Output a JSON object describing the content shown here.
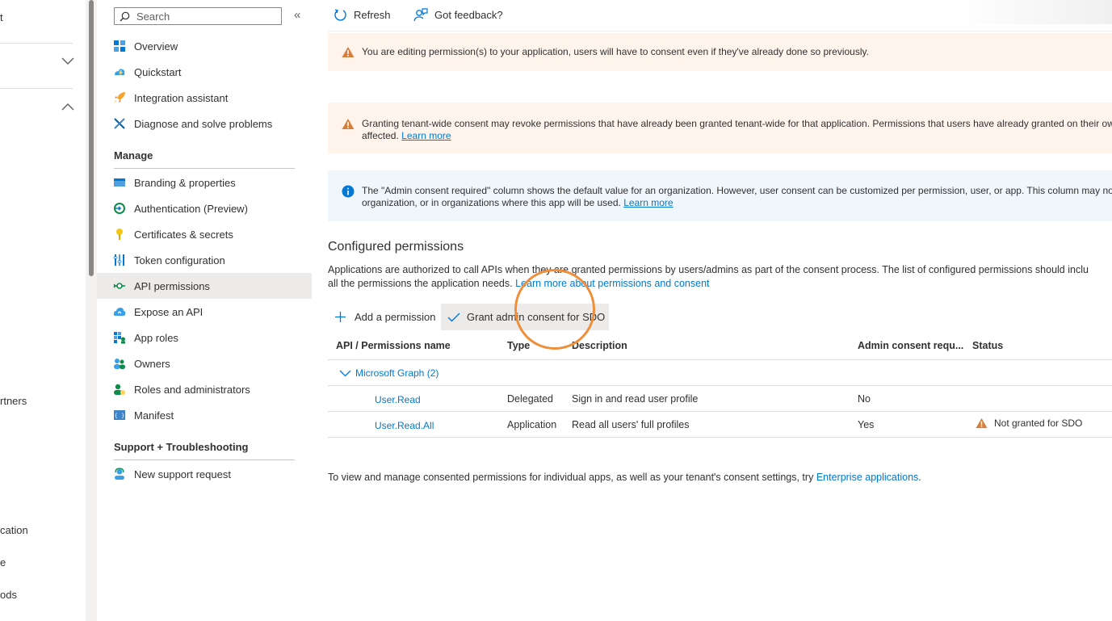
{
  "left_nav": {
    "fragments": [
      "t",
      "rtners",
      "cation",
      "e",
      "ods"
    ]
  },
  "menu": {
    "search_placeholder": "Search",
    "collapse_glyph": "«",
    "items_top": [
      {
        "label": "Overview",
        "icon": "overview-icon"
      },
      {
        "label": "Quickstart",
        "icon": "quickstart-icon"
      },
      {
        "label": "Integration assistant",
        "icon": "rocket-icon"
      },
      {
        "label": "Diagnose and solve problems",
        "icon": "wrench-icon"
      }
    ],
    "manage_header": "Manage",
    "items_manage": [
      {
        "label": "Branding & properties",
        "icon": "branding-icon"
      },
      {
        "label": "Authentication (Preview)",
        "icon": "authentication-icon"
      },
      {
        "label": "Certificates & secrets",
        "icon": "key-icon"
      },
      {
        "label": "Token configuration",
        "icon": "token-icon"
      },
      {
        "label": "API permissions",
        "icon": "api-permissions-icon",
        "selected": true
      },
      {
        "label": "Expose an API",
        "icon": "cloud-icon"
      },
      {
        "label": "App roles",
        "icon": "app-roles-icon"
      },
      {
        "label": "Owners",
        "icon": "owners-icon"
      },
      {
        "label": "Roles and administrators",
        "icon": "roles-icon"
      },
      {
        "label": "Manifest",
        "icon": "manifest-icon"
      }
    ],
    "support_header": "Support + Troubleshooting",
    "items_support": [
      {
        "label": "New support request",
        "icon": "support-icon"
      }
    ]
  },
  "toolbar": {
    "refresh": "Refresh",
    "feedback": "Got feedback?"
  },
  "banners": {
    "editing": "You are editing permission(s) to your application, users will have to consent even if they've already done so previously.",
    "granting_line1": "Granting tenant-wide consent may revoke permissions that have already been granted tenant-wide for that application. Permissions that users have already granted on their ow",
    "granting_line2": "affected.",
    "granting_link": "Learn more",
    "info_line1": "The \"Admin consent required\" column shows the default value for an organization. However, user consent can be customized per permission, user, or app. This column may not",
    "info_line2": "organization, or in organizations where this app will be used.",
    "info_link": "Learn more"
  },
  "configured": {
    "title": "Configured permissions",
    "desc_line1": "Applications are authorized to call APIs when they are granted permissions by users/admins as part of the consent process. The list of configured permissions should inclu",
    "desc_line2": "all the permissions the application needs.",
    "desc_link": "Learn more about permissions and consent",
    "add_permission": "Add a permission",
    "grant_consent": "Grant admin consent for SDO"
  },
  "table": {
    "headers": {
      "name": "API / Permissions name",
      "type": "Type",
      "description": "Description",
      "admin": "Admin consent requ...",
      "status": "Status"
    },
    "group": "Microsoft Graph (2)",
    "rows": [
      {
        "name": "User.Read",
        "type": "Delegated",
        "description": "Sign in and read user profile",
        "admin": "No",
        "status": ""
      },
      {
        "name": "User.Read.All",
        "type": "Application",
        "description": "Read all users' full profiles",
        "admin": "Yes",
        "status": "Not granted for SDO"
      }
    ]
  },
  "footer": {
    "text": "To view and manage consented permissions for individual apps, as well as your tenant's consent settings, try",
    "link": "Enterprise applications",
    "period": "."
  },
  "colors": {
    "accent": "#0078d4",
    "warning": "#d67f3c",
    "highlight_circle": "#ef8f3b",
    "selected_bg": "#edebe9"
  }
}
